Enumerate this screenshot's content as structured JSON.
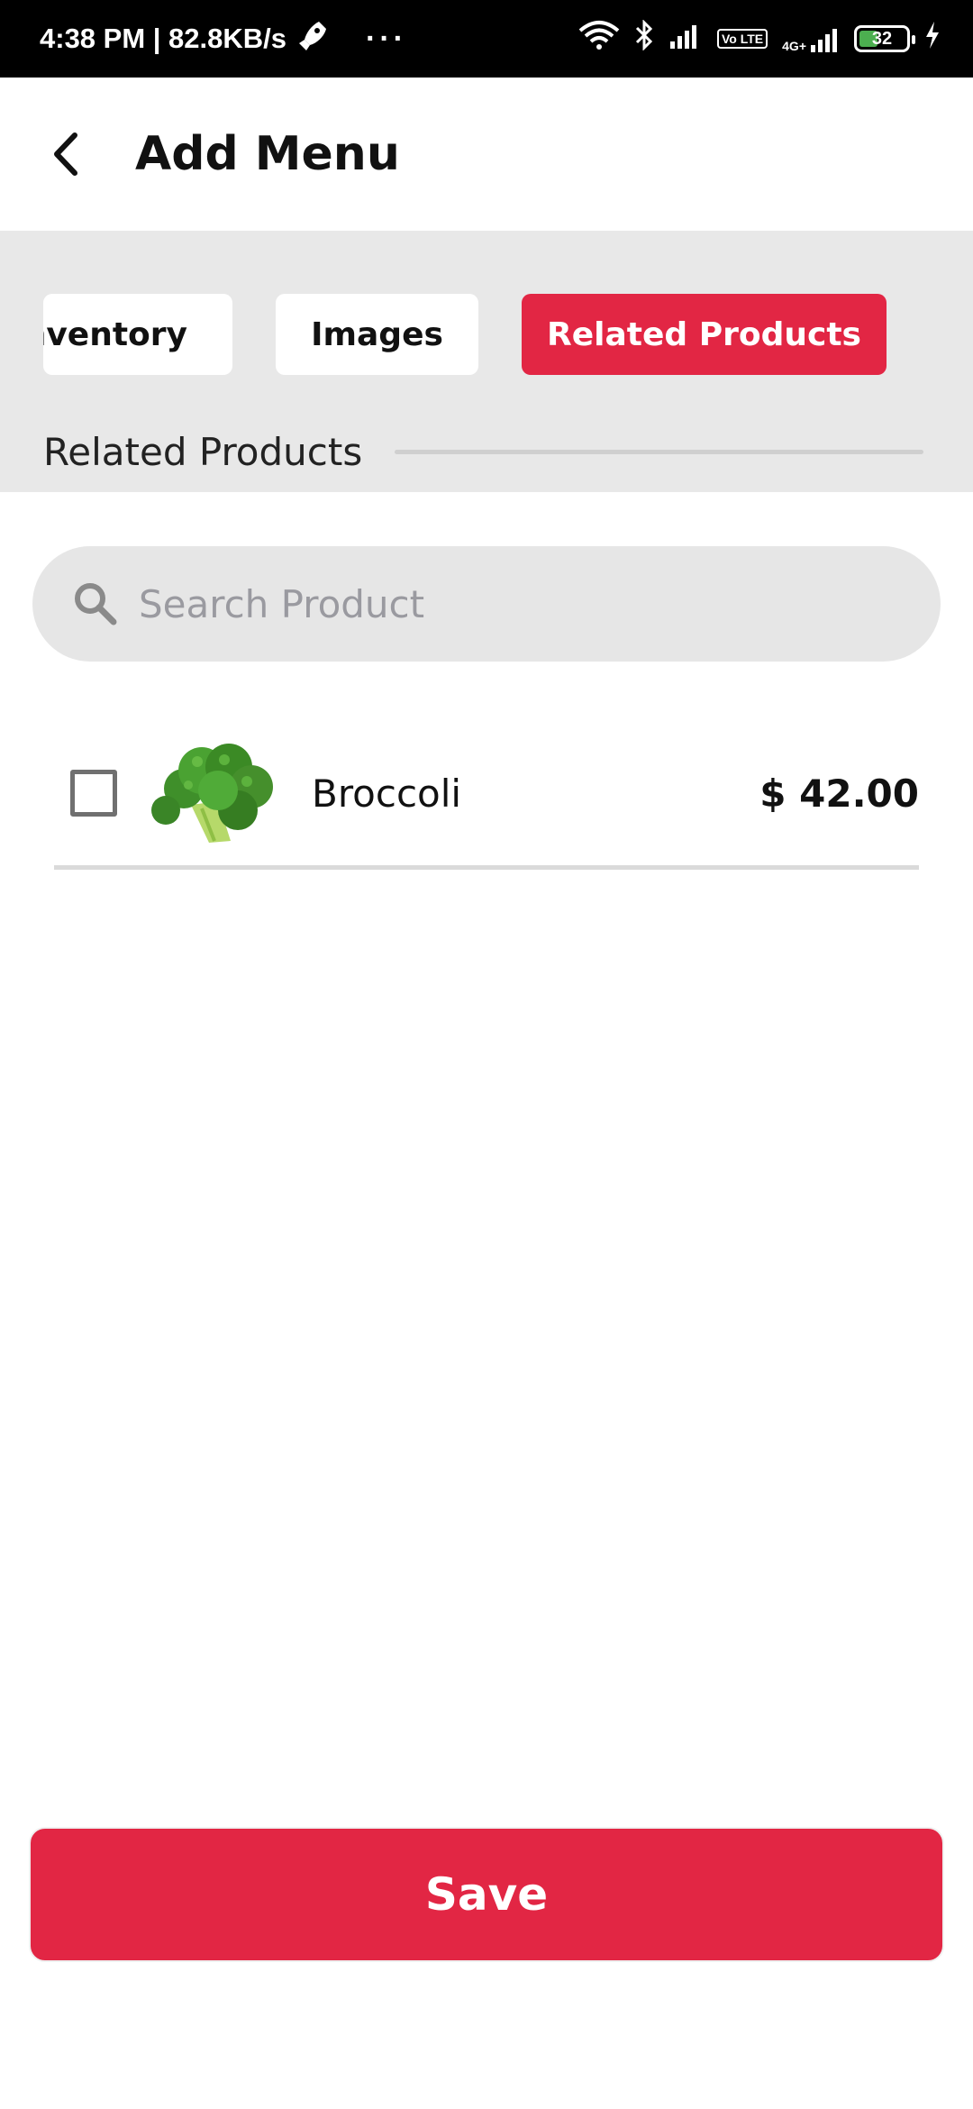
{
  "status_bar": {
    "time_speed": "4:38 PM | 82.8KB/s",
    "dots": "···",
    "volte": "Vo LTE",
    "network": "4G+",
    "battery": "32"
  },
  "appbar": {
    "title": "Add Menu"
  },
  "tabs": {
    "inventory": "Inventory",
    "images": "Images",
    "related": "Related Products",
    "active_color": "#e22644"
  },
  "section": {
    "title": "Related Products"
  },
  "search": {
    "placeholder": "Search Product"
  },
  "products": [
    {
      "name": "Broccoli",
      "price": "$ 42.00",
      "checked": false
    }
  ],
  "footer": {
    "save_label": "Save"
  }
}
